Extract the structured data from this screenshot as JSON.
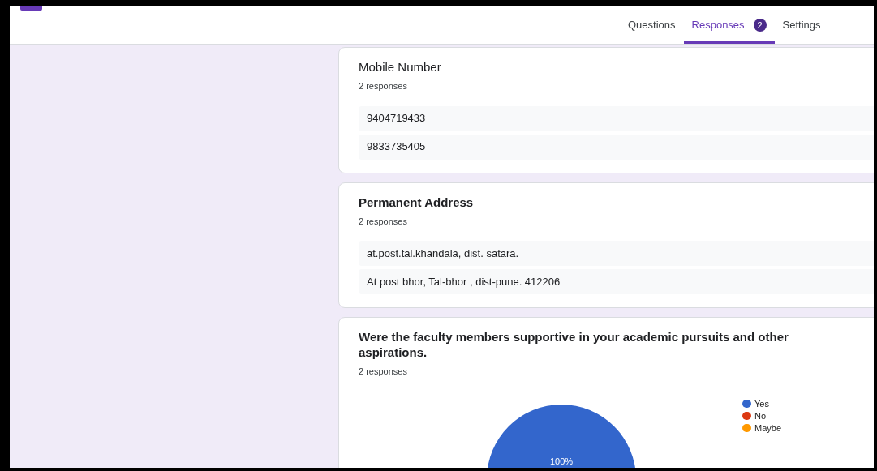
{
  "tabs": [
    {
      "label": "Questions",
      "selected": false
    },
    {
      "label": "Responses",
      "selected": true,
      "badge": "2"
    },
    {
      "label": "Settings",
      "selected": false
    }
  ],
  "questions": [
    {
      "kind": "text",
      "title": "Mobile Number",
      "bold": false,
      "count": "2 responses",
      "answers": [
        "9404719433",
        "9833735405"
      ]
    },
    {
      "kind": "text",
      "title": "Permanent Address",
      "bold": true,
      "count": "2 responses",
      "answers": [
        "at.post.tal.khandala, dist. satara.",
        "At post bhor, Tal-bhor , dist-pune. 412206"
      ]
    },
    {
      "kind": "pie",
      "title": "Were the faculty members supportive in your academic pursuits and other aspirations.",
      "bold": true,
      "count": "2 responses",
      "chart_data": {
        "type": "pie",
        "categories": [
          "Yes",
          "No",
          "Maybe"
        ],
        "series": [
          {
            "values": [
              100,
              0,
              0
            ]
          }
        ],
        "colors": [
          "#3366cc",
          "#dc3912",
          "#ff9900"
        ],
        "value_labels": [
          "100%",
          null,
          null
        ]
      }
    }
  ]
}
